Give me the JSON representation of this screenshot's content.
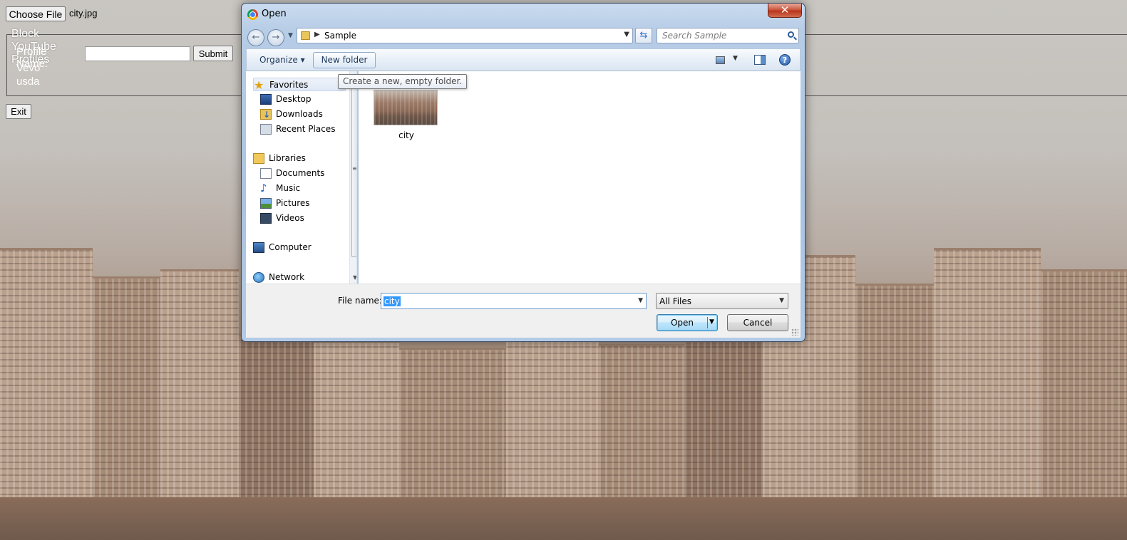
{
  "page": {
    "choose_file_label": "Choose File",
    "selected_file": "city.jpg",
    "legend": "Block YouTube Profiles",
    "profile_label": "Profile Name:",
    "profile_input_value": "",
    "submit_label": "Submit",
    "profiles": [
      "Vevo",
      "usda"
    ],
    "exit_label": "Exit"
  },
  "dialog": {
    "title": "Open",
    "close_glyph": "✕",
    "address": {
      "path": "Sample",
      "search_placeholder": "Search Sample"
    },
    "commandbar": {
      "organize_label": "Organize ▾",
      "new_folder_label": "New folder",
      "help_glyph": "?"
    },
    "tooltip": "Create a new, empty folder.",
    "nav": {
      "items": [
        {
          "label": "Favorites",
          "icon": "star-icon"
        },
        {
          "label": "Desktop",
          "icon": "desktop-icon"
        },
        {
          "label": "Downloads",
          "icon": "downloads-icon"
        },
        {
          "label": "Recent Places",
          "icon": "recent-places-icon"
        },
        {
          "label": "Libraries",
          "icon": "libraries-icon"
        },
        {
          "label": "Documents",
          "icon": "documents-icon"
        },
        {
          "label": "Music",
          "icon": "music-icon"
        },
        {
          "label": "Pictures",
          "icon": "pictures-icon"
        },
        {
          "label": "Videos",
          "icon": "videos-icon"
        },
        {
          "label": "Computer",
          "icon": "computer-icon"
        },
        {
          "label": "Network",
          "icon": "network-icon"
        }
      ]
    },
    "files": [
      {
        "name": "city"
      }
    ],
    "bottom": {
      "file_name_label": "File name:",
      "file_name_value": "city",
      "file_type": "All Files",
      "open_label": "Open",
      "cancel_label": "Cancel"
    }
  },
  "colors": {
    "dialog_frame": "#aac3e1",
    "selection": "#3399ff",
    "open_button": "#bee6fd",
    "close_button": "#c7543a"
  }
}
